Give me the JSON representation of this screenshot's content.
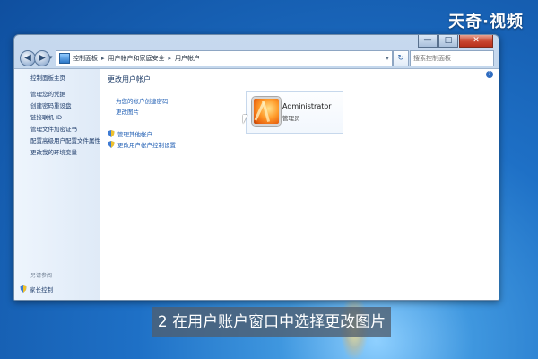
{
  "watermark": {
    "text": "天奇·视频"
  },
  "window": {
    "caption": {
      "min": "—",
      "max": "□",
      "close": "✕"
    },
    "nav": {
      "back": "◀",
      "forward": "▶",
      "dropdown": "▾"
    },
    "breadcrumb": [
      {
        "label": "控制面板"
      },
      {
        "label": "用户帐户和家庭安全"
      },
      {
        "label": "用户帐户"
      }
    ],
    "breadcrumb_separator": "▸",
    "address_dropdown": "▾",
    "refresh": "↻",
    "search": {
      "placeholder": "搜索控制面板"
    }
  },
  "sidebar": {
    "home": "控制面板主页",
    "links": [
      "管理您的凭据",
      "创建密码重设盘",
      "链接联机 ID",
      "管理文件加密证书",
      "配置高级用户配置文件属性",
      "更改我的环境变量"
    ],
    "see_also_title": "另请参阅",
    "see_also": [
      {
        "label": "家长控制",
        "icon": "shield-icon"
      }
    ]
  },
  "main": {
    "title": "更改用户帐户",
    "links": [
      "为您的帐户创建密码",
      "更改图片"
    ],
    "shield_links": [
      "管理其他帐户",
      "更改用户帐户控制设置"
    ]
  },
  "account": {
    "name": "Administrator",
    "role": "管理员"
  },
  "help": "?",
  "subtitle": "2 在用户账户窗口中选择更改图片",
  "colors": {
    "link": "#1e5db3",
    "sidebar_link": "#1f3d6b",
    "title": "#1b3a66"
  }
}
